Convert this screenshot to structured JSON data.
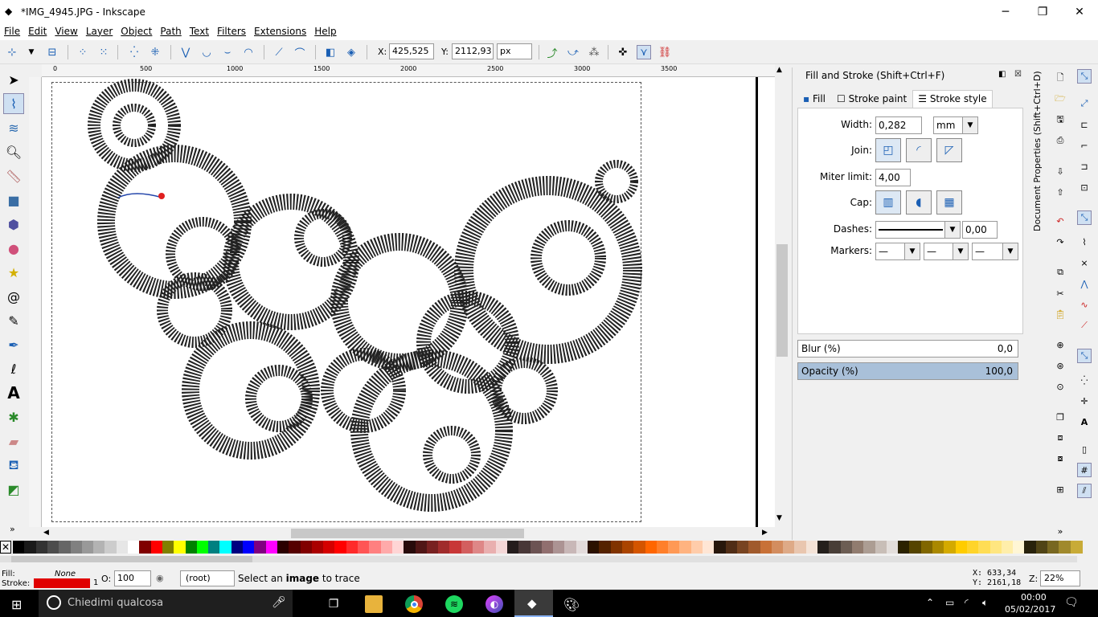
{
  "window": {
    "title": "*IMG_4945.JPG - Inkscape",
    "minimize": "─",
    "maximize": "❐",
    "close": "✕"
  },
  "menu": [
    "File",
    "Edit",
    "View",
    "Layer",
    "Object",
    "Path",
    "Text",
    "Filters",
    "Extensions",
    "Help"
  ],
  "toolcontrols": {
    "x_label": "X:",
    "x_value": "425,525",
    "y_label": "Y:",
    "y_value": "2112,93",
    "unit": "px"
  },
  "rulers": {
    "top": [
      "0",
      "500",
      "1000",
      "1500",
      "2000",
      "2500",
      "3000",
      "3500"
    ]
  },
  "dialog": {
    "title": "Fill and Stroke (Shift+Ctrl+F)",
    "tabs": [
      "Fill",
      "Stroke paint",
      "Stroke style"
    ],
    "width_label": "Width:",
    "width_value": "0,282",
    "width_unit": "mm",
    "join_label": "Join:",
    "miter_label": "Miter limit:",
    "miter_value": "4,00",
    "cap_label": "Cap:",
    "dashes_label": "Dashes:",
    "dashes_offset": "0,00",
    "markers_label": "Markers:",
    "blur_label": "Blur (%)",
    "blur_value": "0,0",
    "opacity_label": "Opacity (%)",
    "opacity_value": "100,0",
    "opacity": 1.0
  },
  "side_tab": "Document Properties (Shift+Ctrl+D)",
  "status": {
    "fill_label": "Fill:",
    "fill_value": "None",
    "stroke_label": "Stroke:",
    "stroke_value": "1",
    "stroke_color": "#e00000",
    "opacity_label": "O:",
    "opacity_value": "100",
    "layer": "(root)",
    "message_pre": "Select an ",
    "message_bold": "image",
    "message_post": " to trace",
    "cursor_x": "X: 633,34",
    "cursor_y": "Y: 2161,18",
    "zoom_label": "Z:",
    "zoom_value": "22%"
  },
  "taskbar": {
    "search": "Chiedimi qualcosa",
    "time": "00:00",
    "date": "05/02/2017"
  },
  "palette": [
    "#000000",
    "#1a1a1a",
    "#333333",
    "#4d4d4d",
    "#666666",
    "#808080",
    "#999999",
    "#b3b3b3",
    "#cccccc",
    "#e6e6e6",
    "#ffffff",
    "#800000",
    "#ff0000",
    "#808000",
    "#ffff00",
    "#008000",
    "#00ff00",
    "#008080",
    "#00ffff",
    "#000080",
    "#0000ff",
    "#800080",
    "#ff00ff",
    "#2b0000",
    "#550000",
    "#800000",
    "#aa0000",
    "#d40000",
    "#ff0000",
    "#ff2a2a",
    "#ff5555",
    "#ff8080",
    "#ffaaaa",
    "#ffd5d5",
    "#280b0b",
    "#501616",
    "#782121",
    "#a02c2c",
    "#c83737",
    "#d35f5f",
    "#de8787",
    "#e9afaf",
    "#f4d7d7",
    "#241c1c",
    "#483737",
    "#6c5353",
    "#916f6f",
    "#ac9393",
    "#c8b7b7",
    "#e3dbdb",
    "#2b1100",
    "#552200",
    "#803300",
    "#aa4400",
    "#d45500",
    "#ff6600",
    "#ff7f2a",
    "#ff9955",
    "#ffb380",
    "#ffccaa",
    "#ffe6d5",
    "#28170b",
    "#502d16",
    "#784421",
    "#a05a2c",
    "#c87137",
    "#d38d5f",
    "#deaa87",
    "#e9c6af",
    "#f4e3d7",
    "#241f1c",
    "#483e37",
    "#6c5d53",
    "#917c6f",
    "#ac9d93",
    "#c8beb7",
    "#e3dedb",
    "#2b2200",
    "#554400",
    "#806600",
    "#aa8800",
    "#d4aa00",
    "#ffcc00",
    "#ffd42a",
    "#ffdd55",
    "#ffe680",
    "#ffeeaa",
    "#fff6d5",
    "#28220b",
    "#504416",
    "#786721",
    "#a0892c",
    "#c8ab37"
  ]
}
